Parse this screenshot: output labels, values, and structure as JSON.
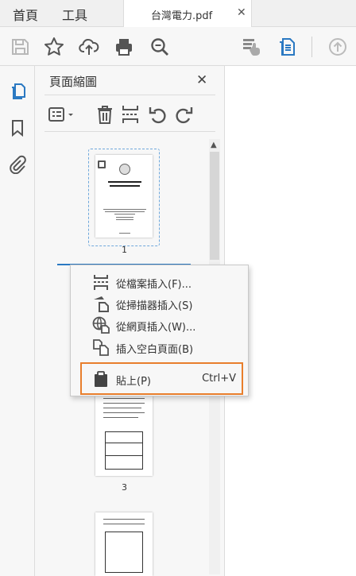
{
  "tabs": {
    "home": "首頁",
    "tools": "工具",
    "document": "台灣電力.pdf",
    "close_glyph": "✕"
  },
  "toolbar": {
    "icons": [
      "save-icon",
      "star-icon",
      "cloud-upload-icon",
      "print-icon",
      "search-icon",
      "touch-mode-icon",
      "fill-form-icon",
      "page-up-icon"
    ]
  },
  "panel": {
    "title": "頁面縮圖",
    "close_glyph": "✕",
    "scroll_up_glyph": "▲",
    "pages": [
      {
        "label": "1"
      },
      {
        "label": "3"
      }
    ]
  },
  "context_menu": {
    "items": [
      {
        "label": "從檔案插入(F)...",
        "icon": "insert-from-file-icon"
      },
      {
        "label": "從掃描器插入(S)",
        "icon": "insert-from-scanner-icon"
      },
      {
        "label": "從網頁插入(W)...",
        "icon": "insert-from-web-icon"
      },
      {
        "label": "插入空白頁面(B)",
        "icon": "insert-blank-page-icon"
      }
    ],
    "paste": {
      "label": "貼上(P)",
      "shortcut": "Ctrl+V",
      "icon": "clipboard-icon"
    }
  },
  "colors": {
    "accent": "#2b79c2",
    "highlight": "#e87e2c"
  }
}
